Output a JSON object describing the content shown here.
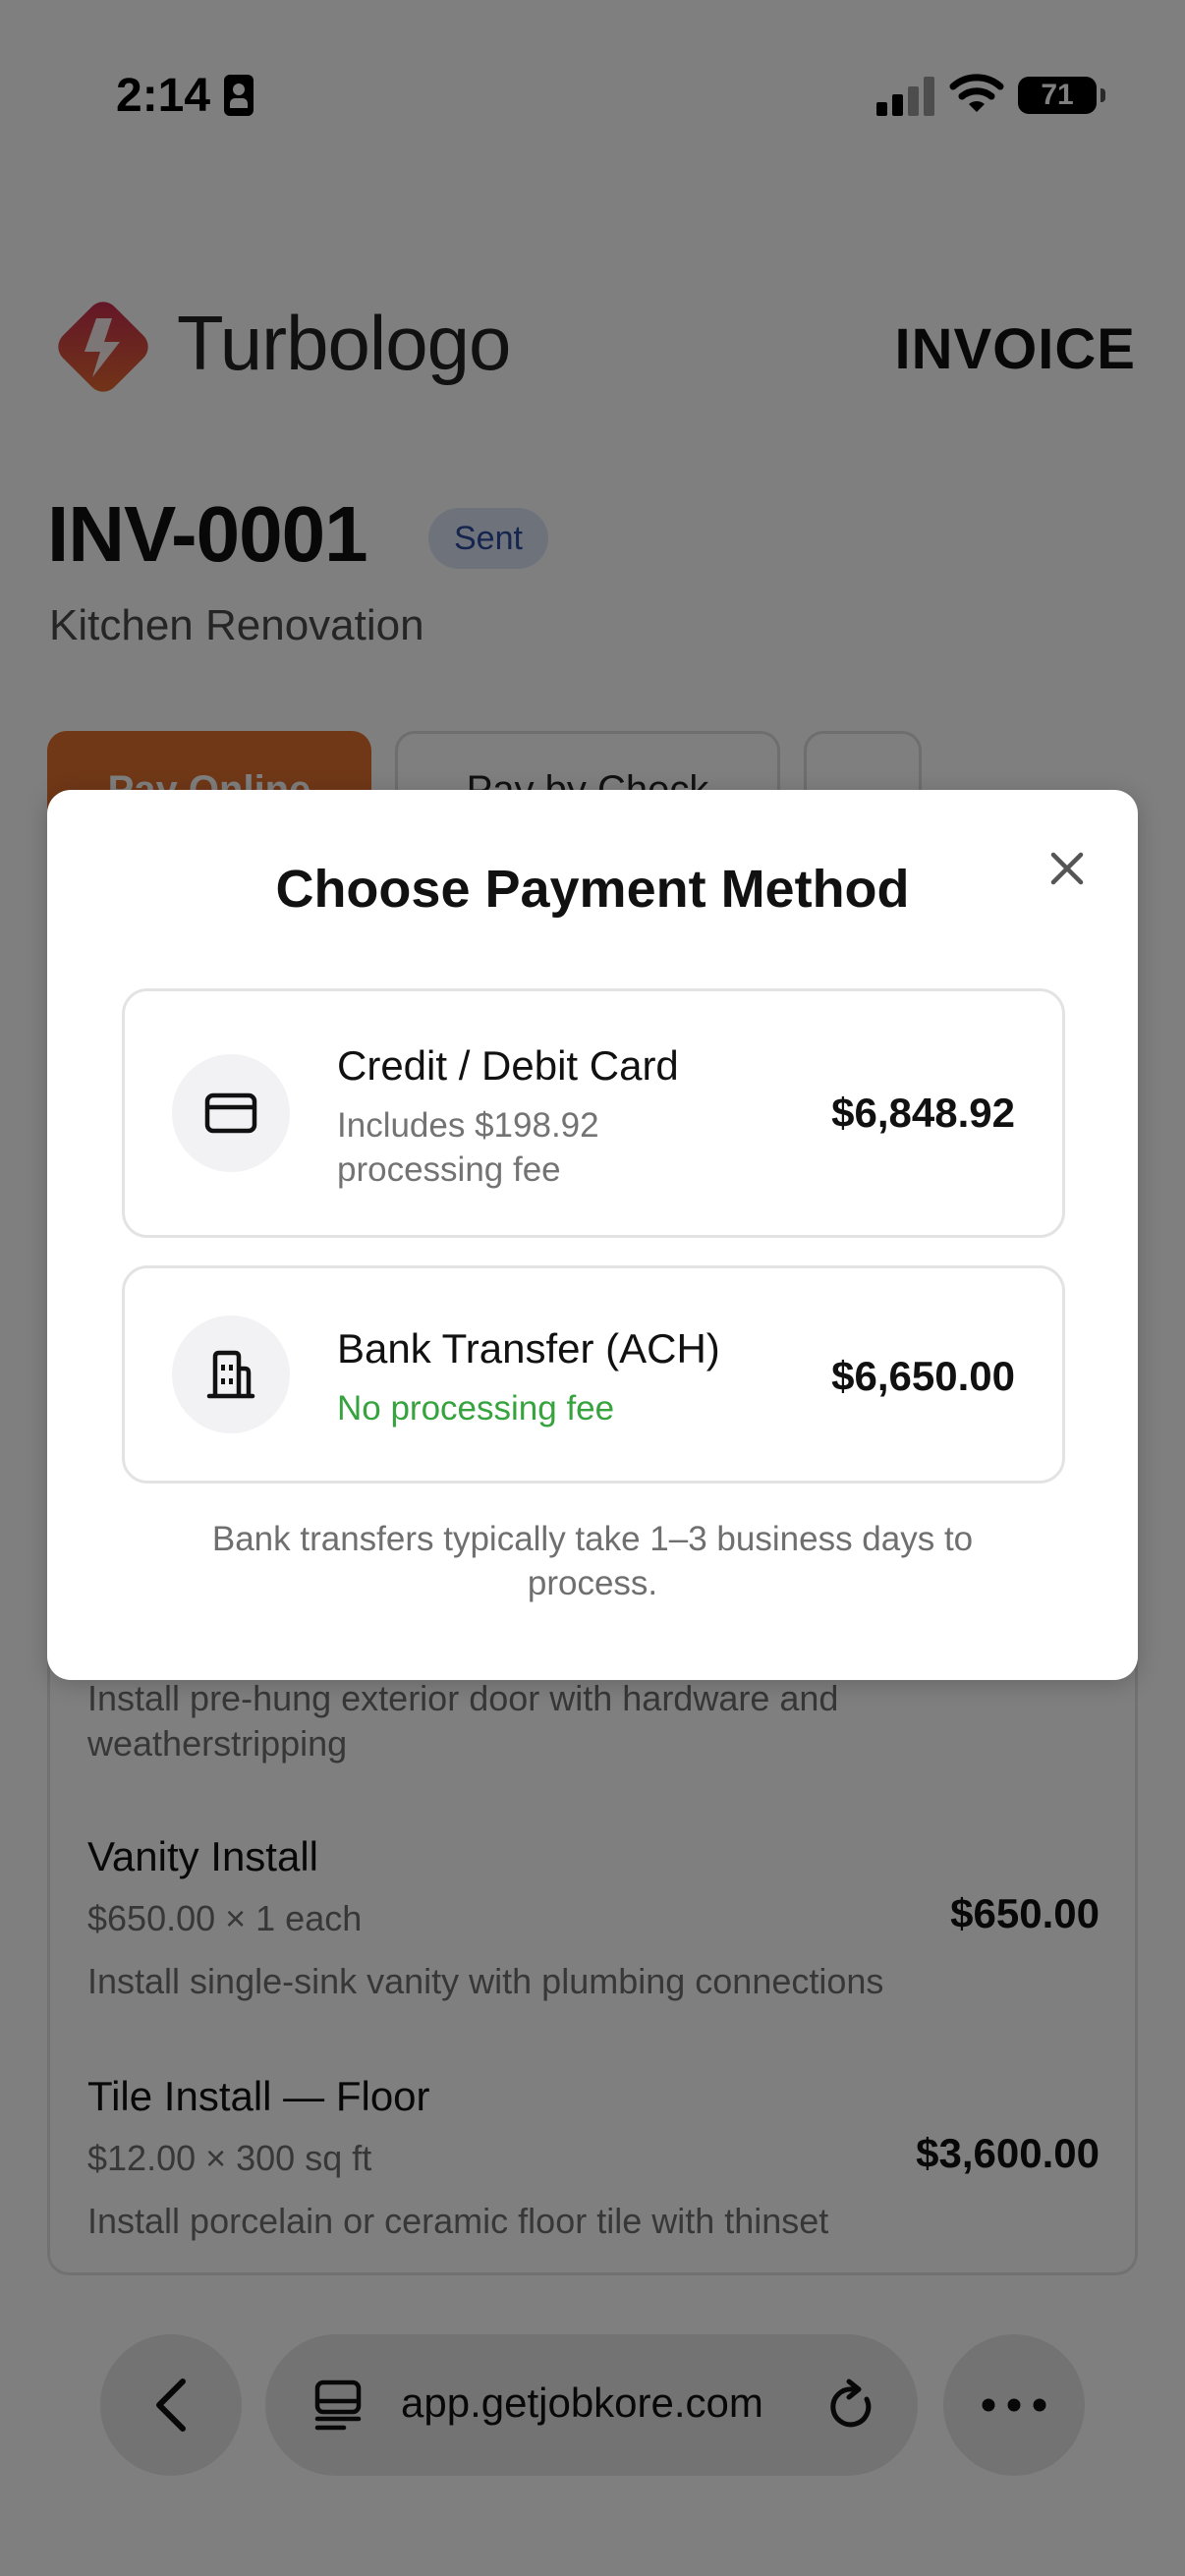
{
  "status_bar": {
    "time": "2:14",
    "battery": "71"
  },
  "header": {
    "brand": "Turbologo",
    "doc_type": "INVOICE"
  },
  "invoice": {
    "number": "INV-0001",
    "status": "Sent",
    "project": "Kitchen Renovation"
  },
  "actions": {
    "pay_online": "Pay Online",
    "pay_by_check": "Pay by Check"
  },
  "line_items": [
    {
      "description": "Install pre-hung exterior door with hardware and weatherstripping"
    },
    {
      "name": "Vanity Install",
      "rate": "$650.00 × 1 each",
      "total": "$650.00",
      "description": "Install single-sink vanity with plumbing connections"
    },
    {
      "name": "Tile Install — Floor",
      "rate": "$12.00 × 300 sq ft",
      "total": "$3,600.00",
      "description": "Install porcelain or ceramic floor tile with thinset"
    }
  ],
  "modal": {
    "title": "Choose Payment Method",
    "options": [
      {
        "title": "Credit / Debit Card",
        "subtitle": "Includes $198.92 processing fee",
        "amount": "$6,848.92",
        "icon": "credit-card-icon"
      },
      {
        "title": "Bank Transfer (ACH)",
        "subtitle": "No processing fee",
        "amount": "$6,650.00",
        "icon": "bank-building-icon"
      }
    ],
    "note": "Bank transfers typically take 1–3 business days to process."
  },
  "browser": {
    "url": "app.getjobkore.com"
  },
  "colors": {
    "accent": "#e0702e",
    "status_badge_bg": "#dde5f6",
    "status_badge_text": "#2d4a9c",
    "no_fee_green": "#37a33f"
  }
}
